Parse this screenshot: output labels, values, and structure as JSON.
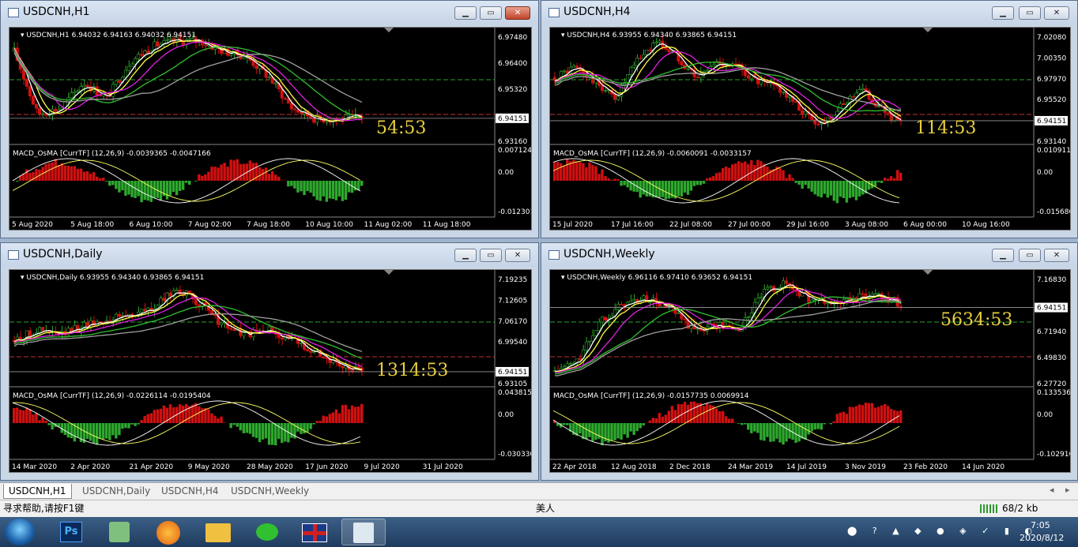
{
  "windows": [
    {
      "id": "h1",
      "title": "USDCNH,H1",
      "active": true,
      "info": "USDCNH,H1  6.94032 6.94163 6.94032 6.94151",
      "prices": [
        "6.97480",
        "6.96400",
        "6.95320",
        "6.94151",
        "6.93160"
      ],
      "timer": "54:53",
      "macd_label": "MACD_OsMA [CurrTF] (12,26,9) -0.0039365 -0.0047166",
      "macd_scale": [
        "0.0071243",
        "0.00",
        "-0.012301"
      ],
      "dates": [
        "5 Aug 2020",
        "5 Aug 18:00",
        "6 Aug 10:00",
        "7 Aug 02:00",
        "7 Aug 18:00",
        "10 Aug 10:00",
        "11 Aug 02:00",
        "11 Aug 18:00"
      ]
    },
    {
      "id": "h4",
      "title": "USDCNH,H4",
      "active": false,
      "info": "USDCNH,H4  6.93955 6.94340 6.93865 6.94151",
      "prices": [
        "7.02080",
        "7.00350",
        "6.97970",
        "6.95520",
        "6.94151",
        "6.93140"
      ],
      "timer": "114:53",
      "macd_label": "MACD_OsMA [CurrTF] (12,26,9) -0.0060091 -0.0033157",
      "macd_scale": [
        "0.0109116",
        "0.00",
        "-0.015680"
      ],
      "dates": [
        "15 Jul 2020",
        "17 Jul 16:00",
        "22 Jul 08:00",
        "27 Jul 00:00",
        "29 Jul 16:00",
        "3 Aug 08:00",
        "6 Aug 00:00",
        "10 Aug 16:00"
      ]
    },
    {
      "id": "daily",
      "title": "USDCNH,Daily",
      "active": false,
      "info": "USDCNH,Daily  6.93955 6.94340 6.93865 6.94151",
      "prices": [
        "7.19235",
        "7.12605",
        "7.06170",
        "6.99540",
        "6.94151",
        "6.93105"
      ],
      "timer": "1314:53",
      "macd_label": "MACD_OsMA [CurrTF] (12,26,9) -0.0226114 -0.0195404",
      "macd_scale": [
        "0.0438156",
        "0.00",
        "-0.030330"
      ],
      "dates": [
        "14 Mar 2020",
        "2 Apr 2020",
        "21 Apr 2020",
        "9 May 2020",
        "28 May 2020",
        "17 Jun 2020",
        "9 Jul 2020",
        "31 Jul 2020"
      ]
    },
    {
      "id": "weekly",
      "title": "USDCNH,Weekly",
      "active": false,
      "info": "USDCNH,Weekly  6.96116 6.97410 6.93652 6.94151",
      "prices": [
        "7.16830",
        "6.94151",
        "6.71940",
        "6.49830",
        "6.27720"
      ],
      "timer": "5634:53",
      "macd_label": "MACD_OsMA [CurrTF] (12,26,9) -0.0157735 0.0069914",
      "macd_scale": [
        "0.1335368",
        "0.00",
        "-0.102916"
      ],
      "dates": [
        "22 Apr 2018",
        "12 Aug 2018",
        "2 Dec 2018",
        "24 Mar 2019",
        "14 Jul 2019",
        "3 Nov 2019",
        "23 Feb 2020",
        "14 Jun 2020"
      ]
    }
  ],
  "tabs": [
    "USDCNH,H1",
    "USDCNH,Daily",
    "USDCNH,H4",
    "USDCNH,Weekly"
  ],
  "status": {
    "help": "寻求帮助,请按F1键",
    "profile": "美人",
    "traffic": "68/2 kb"
  },
  "tray": {
    "time": "7:05",
    "date": "2020/8/12"
  },
  "taskbar": [
    "start-orb",
    "photoshop",
    "paint",
    "firefox",
    "explorer",
    "wechat",
    "uk-flag",
    "mt4"
  ],
  "colors": {
    "bull": "#2ea82e",
    "bear": "#d01010",
    "ma_fast": "#ffffff",
    "ma_mid": "#ffff40",
    "ma_slow": "#e020e0",
    "ma_long": "#30c030",
    "ma_xl": "#a0a0a0",
    "timer": "#e8d040"
  }
}
